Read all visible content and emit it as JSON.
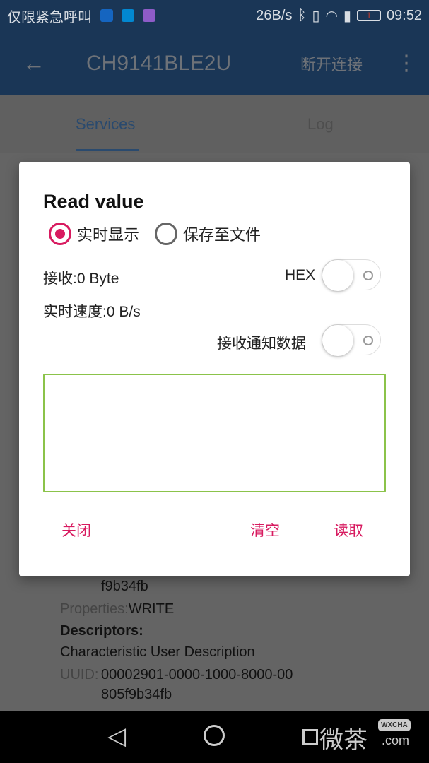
{
  "status_bar": {
    "carrier": "仅限紧急呼叫",
    "speed": "26B/s",
    "battery": "1",
    "time": "09:52"
  },
  "app_bar": {
    "title": "CH9141BLE2U",
    "disconnect": "断开连接"
  },
  "tabs": [
    {
      "label": "Services",
      "active": true
    },
    {
      "label": "Log",
      "active": false
    }
  ],
  "background": {
    "uuid_tail": "f9b34fb",
    "properties_label": "Properties:",
    "properties_value": "WRITE",
    "descriptors": "Descriptors:",
    "descriptor_name": "Characteristic User Description",
    "uuid_label": "UUID:",
    "uuid_line1": "00002901-0000-1000-8000-00",
    "uuid_line2": "805f9b34fb"
  },
  "dialog": {
    "title": "Read value",
    "radio_realtime": "实时显示",
    "radio_save": "保存至文件",
    "selected": "实时显示",
    "received": "接收:0 Byte",
    "speed": "实时速度:0 B/s",
    "hex_label": "HEX",
    "hex_on": false,
    "notify_label": "接收通知数据",
    "notify_on": false,
    "output": "",
    "close": "关闭",
    "clear": "清空",
    "read": "读取"
  },
  "colors": {
    "accent": "#d81b60",
    "appbar": "#1a3656",
    "textbox_border": "#8bc34a"
  },
  "watermark": "微茶 WXCHA .com"
}
